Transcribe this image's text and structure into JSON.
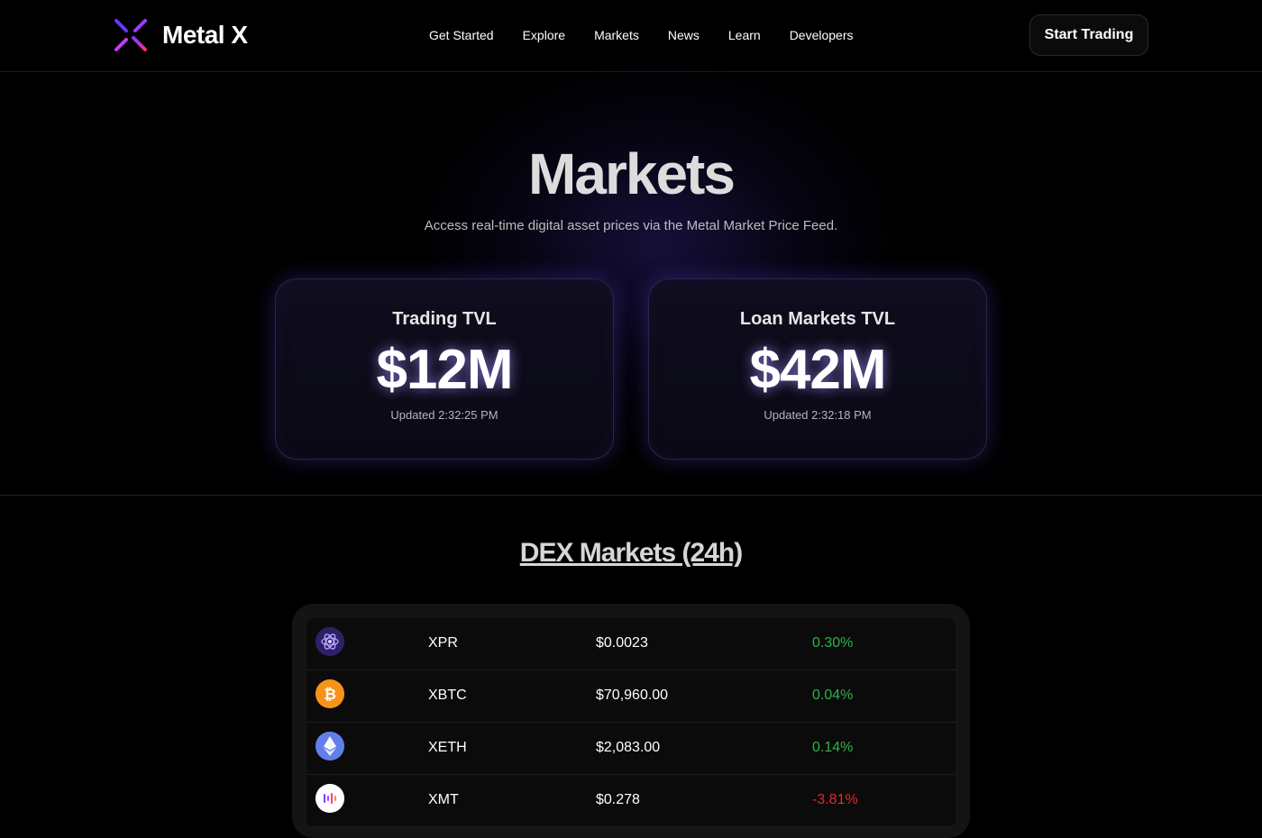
{
  "brand": {
    "name": "Metal X"
  },
  "nav": {
    "items": [
      {
        "label": "Get Started"
      },
      {
        "label": "Explore"
      },
      {
        "label": "Markets"
      },
      {
        "label": "News"
      },
      {
        "label": "Learn"
      },
      {
        "label": "Developers"
      }
    ],
    "cta_label": "Start Trading"
  },
  "hero": {
    "title": "Markets",
    "subtitle": "Access real-time digital asset prices via the Metal Market Price Feed."
  },
  "tvl_cards": [
    {
      "label": "Trading TVL",
      "value": "$12M",
      "updated": "Updated 2:32:25 PM"
    },
    {
      "label": "Loan Markets TVL",
      "value": "$42M",
      "updated": "Updated 2:32:18 PM"
    }
  ],
  "dex": {
    "title": "DEX Markets (24h)",
    "rows": [
      {
        "icon": "xpr-icon",
        "symbol": "XPR",
        "price": "$0.0023",
        "change": "0.30%",
        "direction": "up"
      },
      {
        "icon": "bitcoin-icon",
        "symbol": "XBTC",
        "price": "$70,960.00",
        "change": "0.04%",
        "direction": "up"
      },
      {
        "icon": "ethereum-icon",
        "symbol": "XETH",
        "price": "$2,083.00",
        "change": "0.14%",
        "direction": "up"
      },
      {
        "icon": "xmt-icon",
        "symbol": "XMT",
        "price": "$0.278",
        "change": "-3.81%",
        "direction": "down"
      }
    ]
  },
  "colors": {
    "background": "#000000",
    "positive": "#2db34a",
    "negative": "#e02b2b",
    "accent_glow": "#5a46dc"
  }
}
